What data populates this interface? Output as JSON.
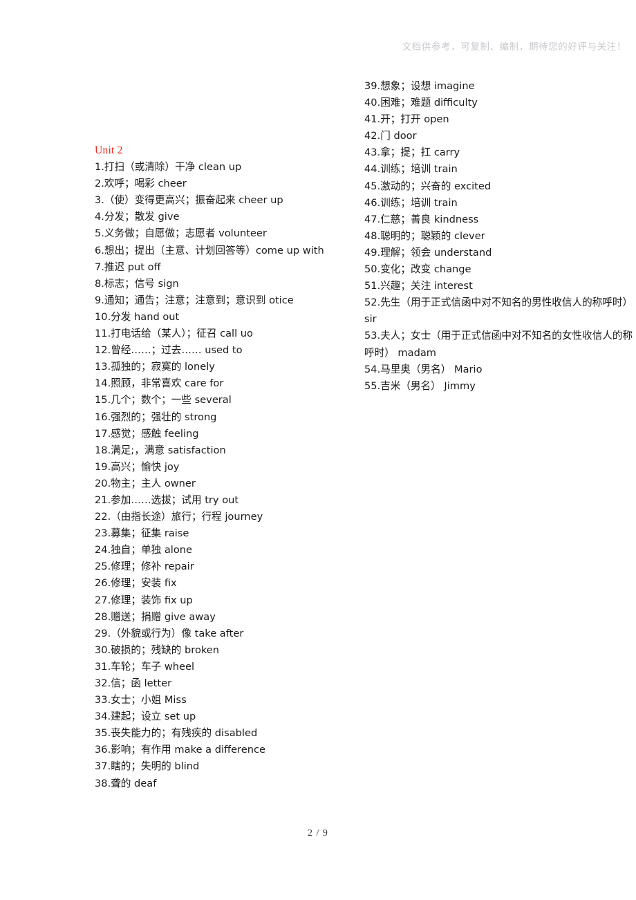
{
  "header": {
    "watermark": "文档供参考，可复制、编制，期待您的好评与关注！"
  },
  "footer": {
    "page_indicator": "2 / 9"
  },
  "colors": {
    "heading": "#e8271c",
    "body_text": "#1a1a1a",
    "watermark": "#c9c9cf",
    "background": "#ffffff"
  },
  "document": {
    "unit_heading": "Unit 2",
    "left_column": [
      "1.打扫（或清除）干净  clean up",
      "2.欢呼；喝彩  cheer",
      "3.（使）变得更高兴；振奋起来  cheer up",
      "4.分发；散发  give",
      "5.义务做；自愿做；志愿者 volunteer",
      "6.想出；提出（主意、计划回答等）come up with",
      "7.推迟  put off",
      "8.标志；信号  sign",
      "9.通知；通告；注意；注意到；意识到  otice",
      "10.分发 hand out",
      "11.打电话给（某人）；征召  call uo",
      "12.曾经……；过去……  used to",
      "13.孤独的；寂寞的  lonely",
      "14.照顾，非常喜欢  care for",
      "15.几个；数个；一些  several",
      "16.强烈的；强壮的  strong",
      "17.感觉；感触  feeling",
      "18.满足;，满意  satisfaction",
      "19.高兴；愉快  joy",
      "20.物主；主人  owner",
      "21.参加……选拔；试用  try out",
      "22.（由指长途）旅行；行程  journey",
      "23.募集；征集  raise",
      "24.独自；单独  alone",
      "25.修理；修补  repair",
      "26.修理；安装  fix",
      "27.修理；装饰  fix up",
      "28.赠送；捐赠  give away",
      "29.（外貌或行为）像  take after",
      "30.破损的；残缺的  broken",
      "31.车轮；车子  wheel",
      "32.信；函  letter",
      "33.女士；小姐  Miss",
      "34.建起；设立  set up",
      "35.丧失能力的；有残疾的  disabled",
      "36.影响；有作用  make a difference",
      "37.瞎的；失明的  blind",
      "38.聋的  deaf"
    ],
    "right_column": [
      "39.想象；设想  imagine",
      "40.困难；难题  difficulty",
      "41.开；打开  open",
      "42.门  door",
      "43.拿；提；扛  carry",
      "44.训练；培训  train",
      "45.激动的；兴奋的  excited",
      "46.训练；培训  train",
      "47.仁慈；善良  kindness",
      "48.聪明的；聪颖的  clever",
      "49.理解；领会  understand",
      "50.变化；改变  change",
      "51.兴趣；关注 interest",
      "52.先生（用于正式信函中对不知名的男性收信人的称呼时）  sir",
      "53.夫人；女士（用于正式信函中对不知名的女性收信人的称呼时）  madam",
      "54.马里奥（男名）  Mario",
      "55.吉米（男名）  Jimmy"
    ]
  }
}
